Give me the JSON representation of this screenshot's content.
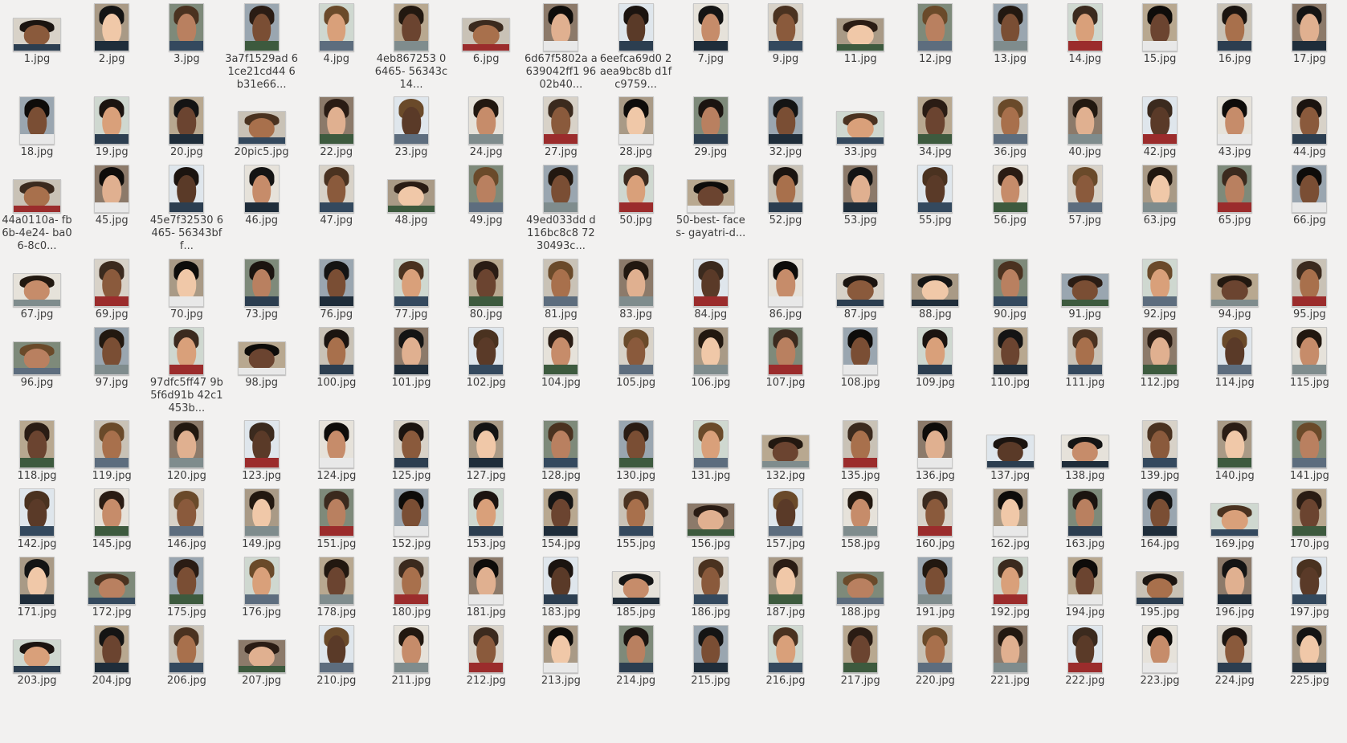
{
  "files": [
    [
      "1.jpg",
      "2.jpg",
      "3.jpg",
      "3a7f1529ad 61ce21cd44 6b31e66...",
      "4.jpg",
      "4eb867253 06465- 56343c14...",
      "6.jpg",
      "6d67f5802a a639042ff1 9602b40...",
      "6eefca69d0 2aea9bc8b d1fc9759...",
      "7.jpg",
      "9.jpg",
      "11.jpg",
      "12.jpg",
      "13.jpg",
      "14.jpg",
      "15.jpg",
      "16.jpg",
      "17.jpg"
    ],
    [
      "18.jpg",
      "19.jpg",
      "20.jpg",
      "20pic5.jpg",
      "22.jpg",
      "23.jpg",
      "24.jpg",
      "27.jpg",
      "28.jpg",
      "29.jpg",
      "32.jpg",
      "33.jpg",
      "34.jpg",
      "36.jpg",
      "40.jpg",
      "42.jpg",
      "43.jpg",
      "44.jpg"
    ],
    [
      "44a0110a- fb6b-4e24- ba06-8c0...",
      "45.jpg",
      "45e7f32530 6465- 56343bff...",
      "46.jpg",
      "47.jpg",
      "48.jpg",
      "49.jpg",
      "49ed033dd d116bc8c8 7230493c...",
      "50.jpg",
      "50-best- faces- gayatri-d...",
      "52.jpg",
      "53.jpg",
      "55.jpg",
      "56.jpg",
      "57.jpg",
      "63.jpg",
      "65.jpg",
      "66.jpg"
    ],
    [
      "67.jpg",
      "69.jpg",
      "70.jpg",
      "73.jpg",
      "76.jpg",
      "77.jpg",
      "80.jpg",
      "81.jpg",
      "83.jpg",
      "84.jpg",
      "86.jpg",
      "87.jpg",
      "88.jpg",
      "90.jpg",
      "91.jpg",
      "92.jpg",
      "94.jpg",
      "95.jpg"
    ],
    [
      "96.jpg",
      "97.jpg",
      "97dfc5ff47 9b5f6d91b 42c1453b...",
      "98.jpg",
      "100.jpg",
      "101.jpg",
      "102.jpg",
      "104.jpg",
      "105.jpg",
      "106.jpg",
      "107.jpg",
      "108.jpg",
      "109.jpg",
      "110.jpg",
      "111.jpg",
      "112.jpg",
      "114.jpg",
      "115.jpg"
    ],
    [
      "118.jpg",
      "119.jpg",
      "120.jpg",
      "123.jpg",
      "124.jpg",
      "125.jpg",
      "127.jpg",
      "128.jpg",
      "130.jpg",
      "131.jpg",
      "132.jpg",
      "135.jpg",
      "136.jpg",
      "137.jpg",
      "138.jpg",
      "139.jpg",
      "140.jpg",
      "141.jpg"
    ],
    [
      "142.jpg",
      "145.jpg",
      "146.jpg",
      "149.jpg",
      "151.jpg",
      "152.jpg",
      "153.jpg",
      "154.jpg",
      "155.jpg",
      "156.jpg",
      "157.jpg",
      "158.jpg",
      "160.jpg",
      "162.jpg",
      "163.jpg",
      "164.jpg",
      "169.jpg",
      "170.jpg"
    ],
    [
      "171.jpg",
      "172.jpg",
      "175.jpg",
      "176.jpg",
      "178.jpg",
      "180.jpg",
      "181.jpg",
      "183.jpg",
      "185.jpg",
      "186.jpg",
      "187.jpg",
      "188.jpg",
      "191.jpg",
      "192.jpg",
      "194.jpg",
      "195.jpg",
      "196.jpg",
      "197.jpg"
    ],
    [
      "203.jpg",
      "204.jpg",
      "206.jpg",
      "207.jpg",
      "210.jpg",
      "211.jpg",
      "212.jpg",
      "213.jpg",
      "214.jpg",
      "215.jpg",
      "216.jpg",
      "217.jpg",
      "220.jpg",
      "221.jpg",
      "222.jpg",
      "223.jpg",
      "224.jpg",
      "225.jpg"
    ]
  ]
}
